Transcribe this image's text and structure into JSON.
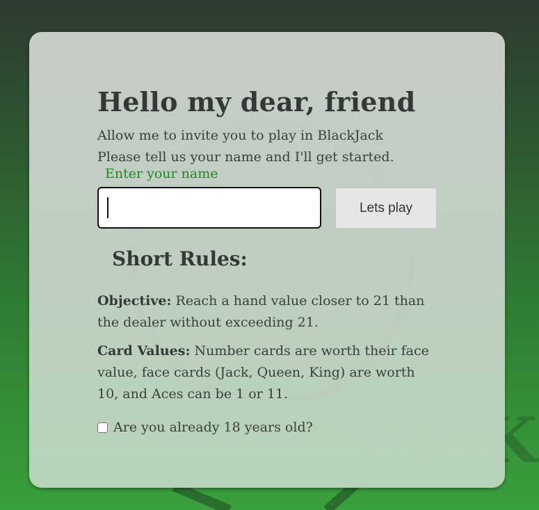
{
  "welcome": {
    "title": "Hello my dear, friend",
    "intro_line1": "Allow me to invite you to play in BlackJack",
    "intro_line2": "Please tell us your name and I'll get started."
  },
  "name_form": {
    "label": "Enter your name",
    "input_value": "",
    "button_label": "Lets play"
  },
  "rules": {
    "title": "Short Rules:",
    "objective_label": "Objective:",
    "objective_text": " Reach a hand value closer to 21 than the dealer without exceeding 21.",
    "values_label": "Card Values:",
    "values_text": " Number cards are worth their face value, face cards (Jack, Queen, King) are worth 10, and Aces can be 1 or 11."
  },
  "age_check": {
    "label": "Are you already 18 years old?",
    "checked": false
  },
  "background": {
    "logo_text": "JACK"
  },
  "colors": {
    "label_green": "#1f8a1f",
    "card_bg": "#c8d2c9",
    "page_green": "#38a03c"
  }
}
